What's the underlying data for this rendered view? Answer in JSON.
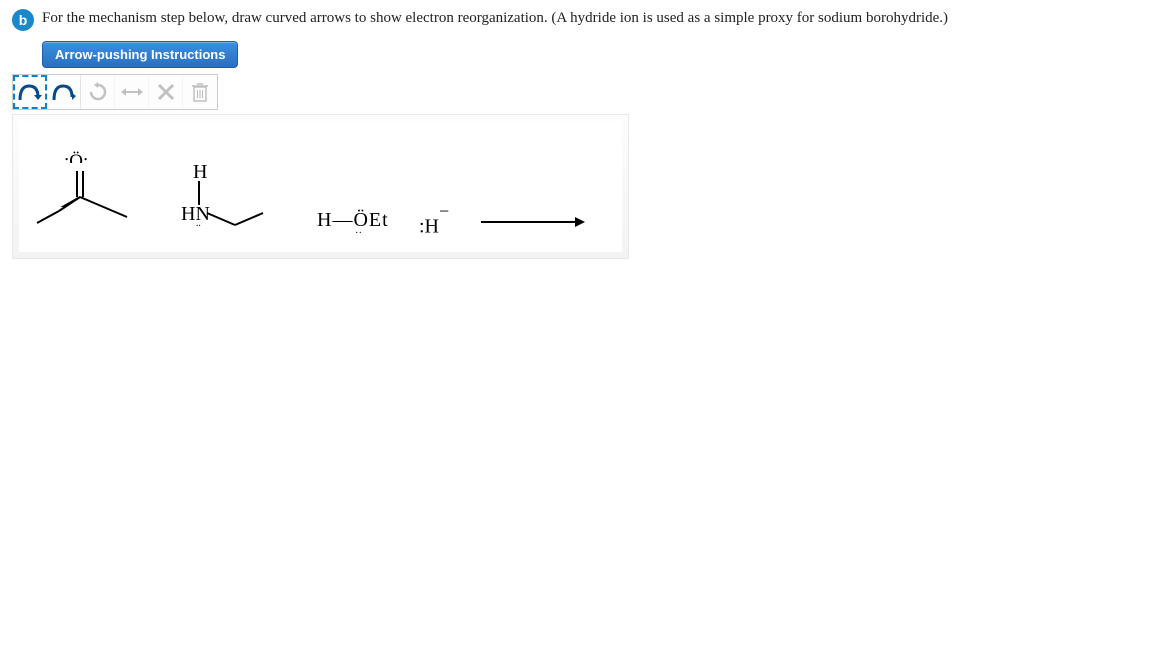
{
  "part": {
    "letter": "b",
    "prompt": "For the mechanism step below, draw curved arrows to show electron reorganization. (A hydride ion is used as a simple proxy for sodium borohydride.)"
  },
  "buttons": {
    "instructions": "Arrow-pushing Instructions"
  },
  "tools": {
    "double_arrow": "double-curved-arrow",
    "single_arrow": "single-curved-arrow",
    "reload": "reload",
    "resize": "resize",
    "delete": "delete-x",
    "trash": "trash"
  },
  "chem": {
    "o_label": ":Ö:",
    "h_top": "H",
    "hn": "HN",
    "hoet": "H—ÖEt",
    "hydride": ":H",
    "minus": "−"
  }
}
